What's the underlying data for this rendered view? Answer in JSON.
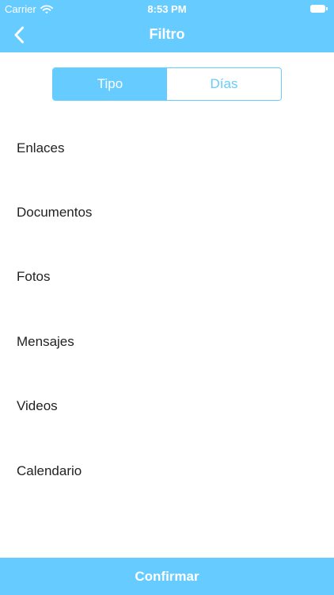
{
  "status_bar": {
    "carrier": "Carrier",
    "time": "8:53 PM",
    "icons": [
      "wifi-icon",
      "battery-icon"
    ]
  },
  "nav": {
    "title": "Filtro",
    "back_icon": "chevron-left-icon"
  },
  "segments": [
    {
      "label": "Tipo",
      "selected": true
    },
    {
      "label": "Días",
      "selected": false
    }
  ],
  "filter_items": [
    {
      "label": "Enlaces"
    },
    {
      "label": "Documentos"
    },
    {
      "label": "Fotos"
    },
    {
      "label": "Mensajes"
    },
    {
      "label": "Videos"
    },
    {
      "label": "Calendario"
    }
  ],
  "confirm_label": "Confirmar",
  "colors": {
    "accent": "#66ccff",
    "text": "#222222",
    "background": "#ffffff"
  }
}
